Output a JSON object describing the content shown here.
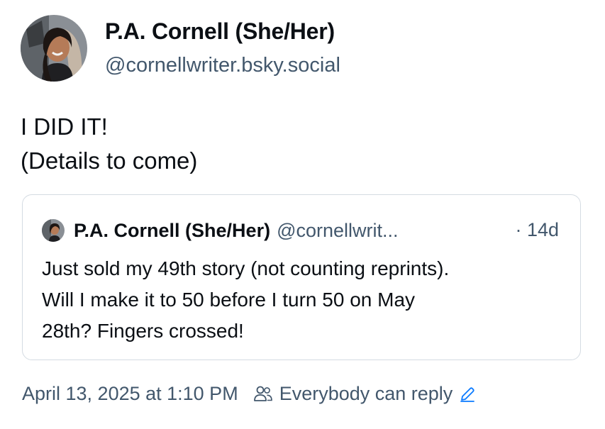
{
  "author": {
    "display_name": "P.A. Cornell (She/Her)",
    "handle": "@cornellwriter.bsky.social"
  },
  "post": {
    "lines": [
      "I DID IT!",
      "(Details to come)"
    ]
  },
  "quoted_post": {
    "author_name": "P.A. Cornell (She/Her)",
    "author_handle": "@cornellwrit...",
    "time": "· 14d",
    "lines": [
      "Just sold my 49th story (not counting reprints).",
      "Will I make it to 50 before I turn 50 on May",
      "28th? Fingers crossed!"
    ]
  },
  "footer": {
    "timestamp": "April 13, 2025 at 1:10 PM",
    "reply_setting": "Everybody can reply"
  },
  "colors": {
    "text": "#0b0f14",
    "secondary": "#42576c",
    "accent": "#0a7aff",
    "border": "#d4dbe2"
  },
  "icons": {
    "reply_setting": "people-icon",
    "edit": "pencil-icon"
  }
}
